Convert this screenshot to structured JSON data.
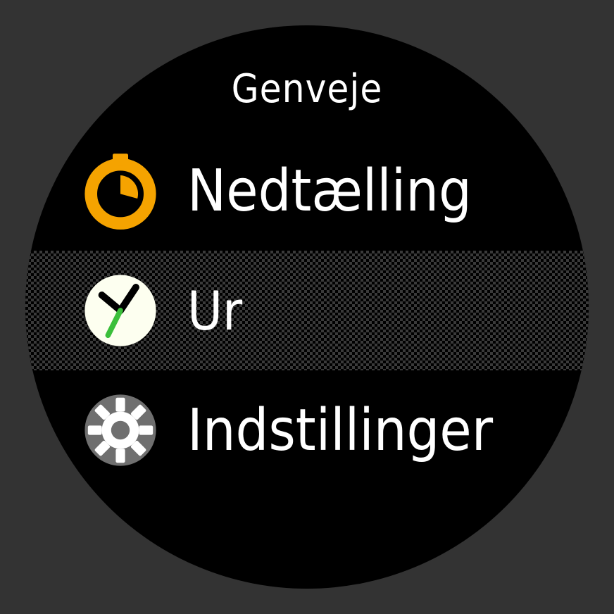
{
  "header": {
    "title": "Genveje"
  },
  "menu": {
    "items": [
      {
        "label": "Nedtælling",
        "icon": "timer-icon",
        "selected": false
      },
      {
        "label": "Ur",
        "icon": "clock-icon",
        "selected": true
      },
      {
        "label": "Indstillinger",
        "icon": "settings-icon",
        "selected": false
      }
    ]
  },
  "colors": {
    "accent": "#f5a300",
    "selected_bg": "#3a3a3a",
    "clock_face": "#fdfff0",
    "clock_sec": "#3bbf3b",
    "settings_bg": "#6f6f6f"
  }
}
